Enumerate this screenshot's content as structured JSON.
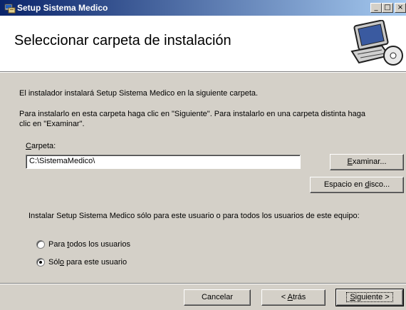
{
  "window": {
    "title": "Setup Sistema Medico",
    "controls": {
      "minimize": "_",
      "maximize": "□",
      "close": "×"
    }
  },
  "header": {
    "title": "Seleccionar carpeta de instalación",
    "icon": "computer-cd-icon"
  },
  "body": {
    "intro": "El instalador instalará Setup Sistema Medico en la siguiente carpeta.",
    "instructions_line1": "Para instalarlo en esta carpeta haga clic en \"Siguiente\". Para instalarlo en una carpeta distinta haga",
    "instructions_line2": "clic en \"Examinar\".",
    "folder_label": {
      "mnemonic": "C",
      "rest": "arpeta:"
    },
    "folder_value": "C:\\SistemaMedico\\",
    "browse_button": {
      "mnemonic": "E",
      "rest": "xaminar..."
    },
    "disk_space_button": {
      "before": "Espacio en ",
      "mnemonic": "d",
      "rest": "isco..."
    },
    "scope_question": "Instalar Setup Sistema Medico sólo para este usuario o para todos los usuarios de este equipo:",
    "radio_all": {
      "before": "Para ",
      "mnemonic": "t",
      "rest": "odos los usuarios",
      "checked": false
    },
    "radio_me": {
      "before": "Sól",
      "mnemonic": "o",
      "rest": " para este usuario",
      "checked": true
    }
  },
  "footer": {
    "cancel": "Cancelar",
    "back": {
      "before": "< ",
      "mnemonic": "A",
      "rest": "trás"
    },
    "next": {
      "mnemonic": "S",
      "rest": "iguiente >"
    }
  }
}
